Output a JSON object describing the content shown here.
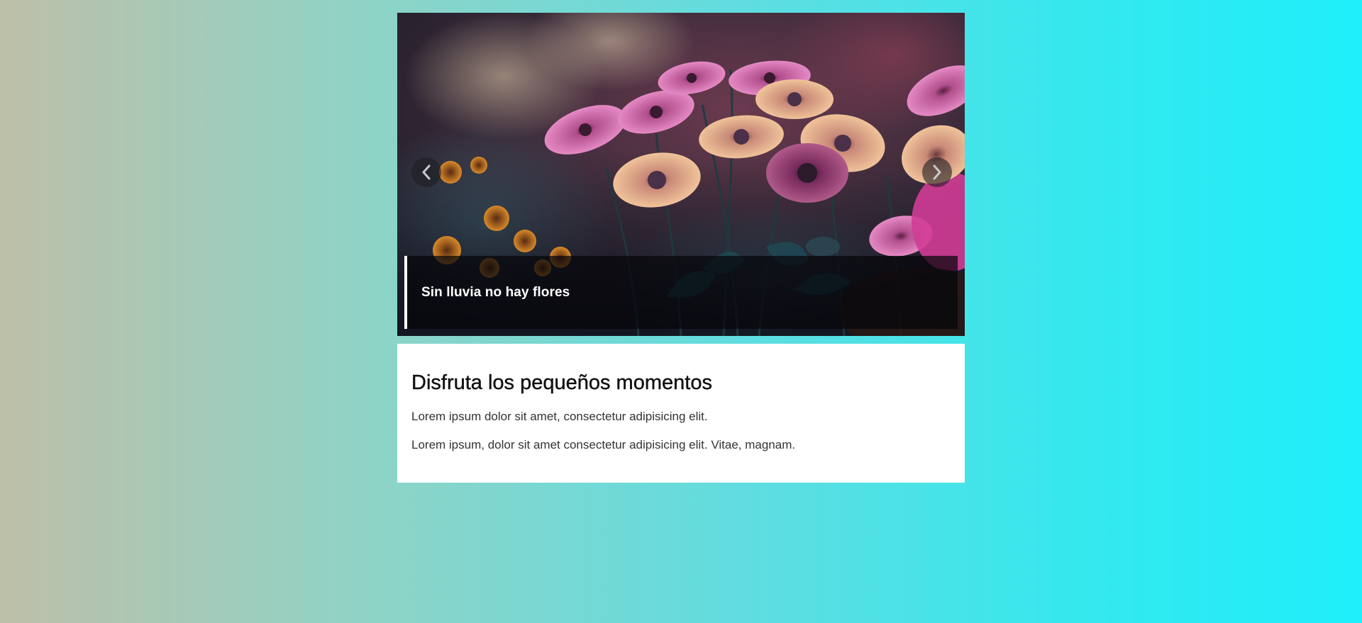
{
  "slider": {
    "image_alt": "Flores de colores rosa y melocotón con fondo difuminado",
    "caption": "Sin lluvia no hay flores",
    "prev_icon": "chevron-left-icon",
    "next_icon": "chevron-right-icon"
  },
  "card": {
    "title": "Disfruta los pequeños momentos",
    "paragraphs": [
      "Lorem ipsum dolor sit amet, consectetur adipisicing elit.",
      "Lorem ipsum, dolor sit amet consectetur adipisicing elit. Vitae, magnam."
    ]
  },
  "colors": {
    "background_left": "#bdbfa8",
    "background_right": "#1eeefa",
    "card_background": "#ffffff",
    "caption_overlay": "#05050a",
    "caption_accent": "#ffffff"
  }
}
